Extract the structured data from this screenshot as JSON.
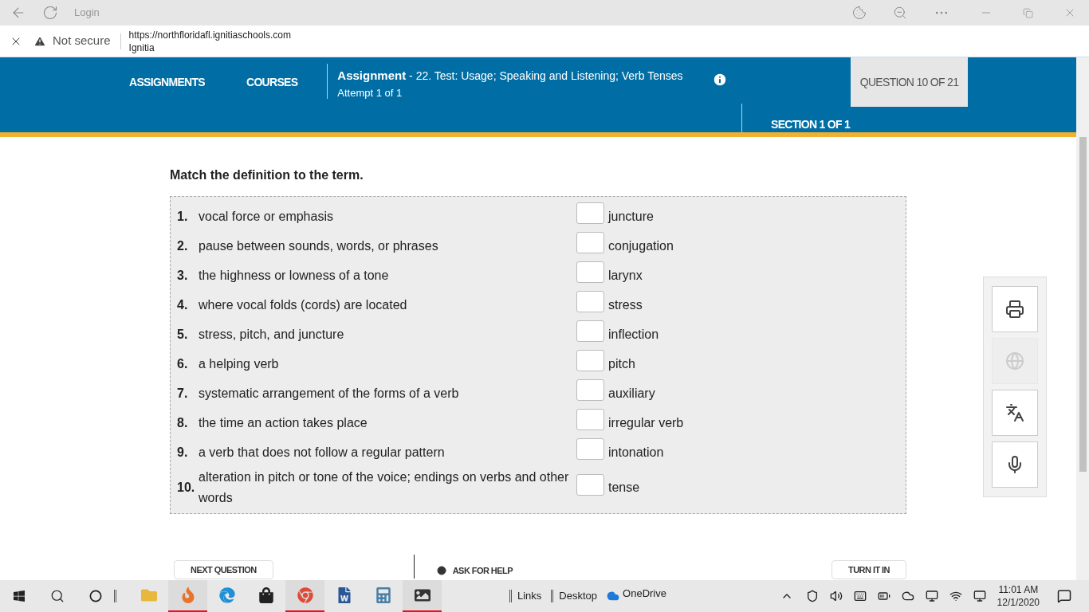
{
  "browser": {
    "page_title": "Login",
    "security": "Not secure",
    "url": "https://northfloridafl.ignitiaschools.com",
    "site_name": "Ignitia"
  },
  "header": {
    "nav": [
      {
        "label": "ASSIGNMENTS"
      },
      {
        "label": "COURSES"
      }
    ],
    "assignment_label": "Assignment",
    "assignment_title": "- 22. Test: Usage; Speaking and Listening; Verb Tenses",
    "attempt": "Attempt 1 of 1",
    "question_counter": "QUESTION 10 OF 21",
    "section": "SECTION 1 OF 1"
  },
  "question": {
    "prompt": "Match the definition to the term.",
    "rows": [
      {
        "number": "1.",
        "definition": "vocal force or emphasis",
        "term": "juncture"
      },
      {
        "number": "2.",
        "definition": "pause between sounds, words, or phrases",
        "term": "conjugation"
      },
      {
        "number": "3.",
        "definition": "the highness or lowness of a tone",
        "term": "larynx"
      },
      {
        "number": "4.",
        "definition": "where vocal folds (cords) are located",
        "term": "stress"
      },
      {
        "number": "5.",
        "definition": "stress, pitch, and juncture",
        "term": "inflection"
      },
      {
        "number": "6.",
        "definition": "a helping verb",
        "term": "pitch"
      },
      {
        "number": "7.",
        "definition": "systematic arrangement of the forms of a verb",
        "term": "auxiliary"
      },
      {
        "number": "8.",
        "definition": "the time an action takes place",
        "term": "irregular verb"
      },
      {
        "number": "9.",
        "definition": "a verb that does not follow a regular pattern",
        "term": "intonation"
      },
      {
        "number": "10.",
        "definition": "alteration in pitch or tone of the voice; endings on verbs and other words",
        "term": "tense"
      }
    ]
  },
  "tools": [
    {
      "kind": "print",
      "disabled": false
    },
    {
      "kind": "globe",
      "disabled": true
    },
    {
      "kind": "translate",
      "disabled": false
    },
    {
      "kind": "microphone",
      "disabled": false
    }
  ],
  "footer": {
    "next": "NEXT QUESTION",
    "help": "ASK FOR HELP",
    "turn_in": "TURN IT IN"
  },
  "taskbar": {
    "apps": [
      {
        "kind": "explorer",
        "running": false
      },
      {
        "kind": "ignitia",
        "running": true
      },
      {
        "kind": "edge",
        "running": false
      },
      {
        "kind": "store",
        "running": false
      },
      {
        "kind": "chrome",
        "running": true
      },
      {
        "kind": "word",
        "running": false
      },
      {
        "kind": "calculator",
        "running": false
      },
      {
        "kind": "photos",
        "running": true
      }
    ],
    "toolbars": [
      {
        "label": "Links"
      },
      {
        "label": "Desktop"
      }
    ],
    "onedrive": "OneDrive",
    "time": "11:01 AM",
    "date": "12/1/2020"
  }
}
